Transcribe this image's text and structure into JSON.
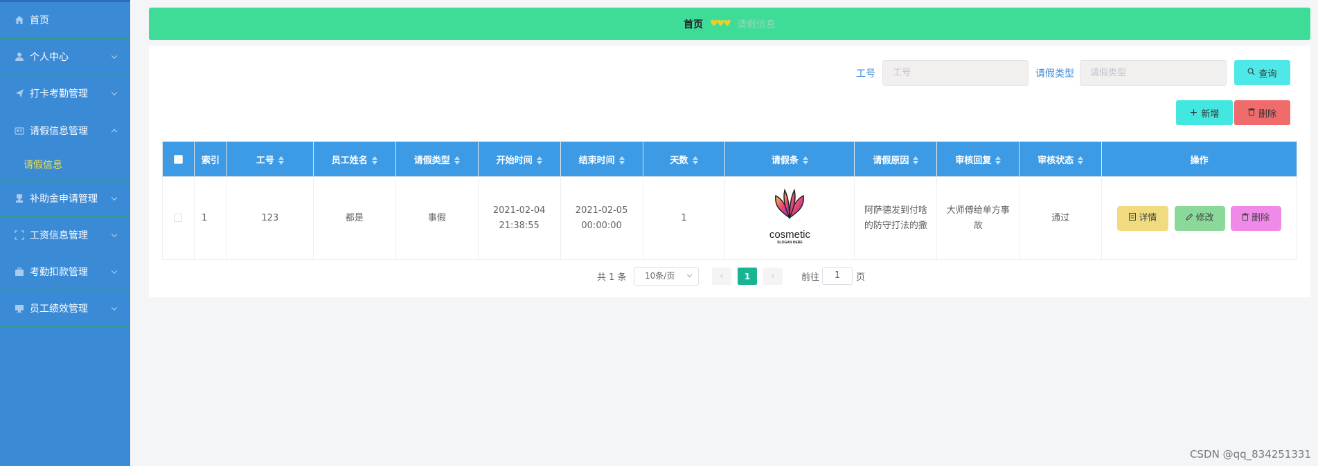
{
  "sidebar": {
    "items": [
      {
        "label": "首页",
        "icon": "home-icon",
        "has_arrow": false
      },
      {
        "label": "个人中心",
        "icon": "user-icon",
        "has_arrow": true
      },
      {
        "label": "打卡考勤管理",
        "icon": "send-icon",
        "has_arrow": true
      },
      {
        "label": "请假信息管理",
        "icon": "id-card-icon",
        "has_arrow": true,
        "open": true,
        "children": [
          {
            "label": "请假信息",
            "active": true
          }
        ]
      },
      {
        "label": "补助金申请管理",
        "icon": "stamp-icon",
        "has_arrow": true
      },
      {
        "label": "工资信息管理",
        "icon": "fullscreen-icon",
        "has_arrow": true
      },
      {
        "label": "考勤扣款管理",
        "icon": "suitcase-icon",
        "has_arrow": true
      },
      {
        "label": "员工绩效管理",
        "icon": "monitor-icon",
        "has_arrow": true
      }
    ]
  },
  "breadcrumb": {
    "home": "首页",
    "separator": "♥♥♥",
    "current": "请假信息"
  },
  "search": {
    "field1_label": "工号",
    "field1_placeholder": "工号",
    "field2_label": "请假类型",
    "field2_placeholder": "请假类型",
    "query_label": "查询"
  },
  "actions": {
    "add_label": "新增",
    "delete_label": "删除"
  },
  "table": {
    "headers": [
      "索引",
      "工号",
      "员工姓名",
      "请假类型",
      "开始时间",
      "结束时间",
      "天数",
      "请假条",
      "请假原因",
      "审核回复",
      "审核状态",
      "操作"
    ],
    "rows": [
      {
        "index": "1",
        "emp_no": "123",
        "name": "都是",
        "leave_type": "事假",
        "start": "2021-02-04 21:38:55",
        "end": "2021-02-05 00:00:00",
        "days": "1",
        "logo_text": "cosmetic",
        "logo_slogan": "SLOGAN HERE",
        "reason": "阿萨德发到付啥的防守打法的撒",
        "reply": "大师傅给单方事故",
        "status": "通过",
        "ops": {
          "detail": "详情",
          "edit": "修改",
          "delete": "删除"
        }
      }
    ]
  },
  "pager": {
    "total": "共 1 条",
    "page_size": "10条/页",
    "current_page": "1",
    "goto_label": "前往",
    "goto_value": "1",
    "page_unit": "页"
  },
  "watermark": "CSDN @qq_834251331",
  "colors": {
    "sidebar": "#3a8ad6",
    "breadcrumb": "#3fdc98",
    "table_header": "#3d9be6",
    "query_button": "#4ee8e8",
    "add_button": "#42e8e0",
    "delete_button": "#f06b6b",
    "detail_button": "#f0dc7e",
    "edit_button": "#8bd99a",
    "op_delete_button": "#f08ae8",
    "pager_active": "#19b592"
  }
}
